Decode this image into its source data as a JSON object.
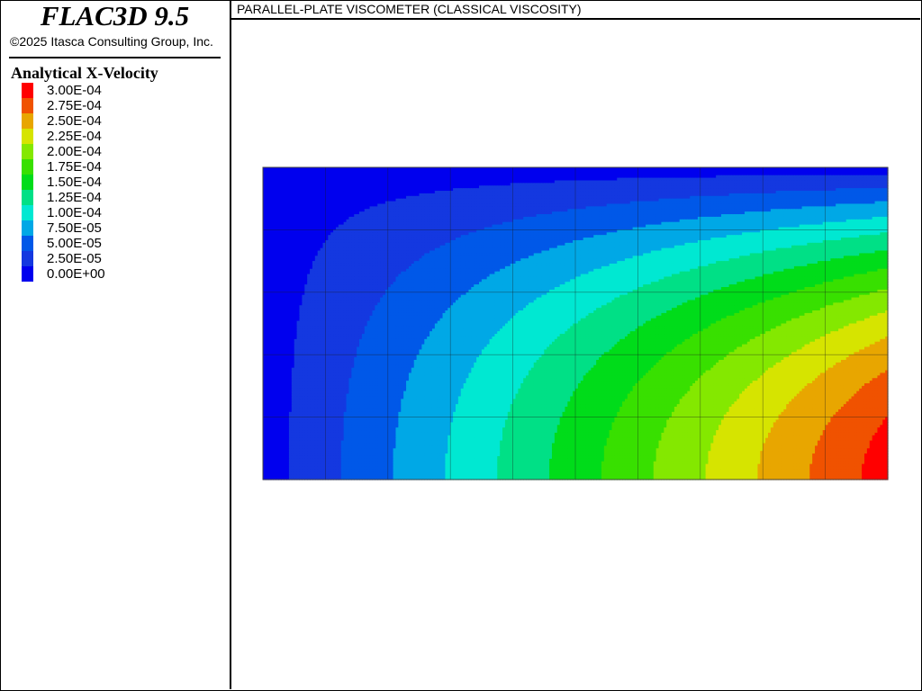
{
  "app": {
    "title": "FLAC3D 9.5",
    "copyright": "©2025 Itasca Consulting Group, Inc."
  },
  "view": {
    "title": "PARALLEL-PLATE VISCOMETER (CLASSICAL VISCOSITY)"
  },
  "legend": {
    "title": "Analytical X-Velocity",
    "entries": [
      {
        "label": "3.00E-04",
        "color": "#ff0000"
      },
      {
        "label": "2.75E-04",
        "color": "#f05200"
      },
      {
        "label": "2.50E-04",
        "color": "#e8a600"
      },
      {
        "label": "2.25E-04",
        "color": "#d6e400"
      },
      {
        "label": "2.00E-04",
        "color": "#84e800"
      },
      {
        "label": "1.75E-04",
        "color": "#38e000"
      },
      {
        "label": "1.50E-04",
        "color": "#00dc1a"
      },
      {
        "label": "1.25E-04",
        "color": "#00e086"
      },
      {
        "label": "1.00E-04",
        "color": "#00e8d2"
      },
      {
        "label": "7.50E-05",
        "color": "#00a8e6"
      },
      {
        "label": "5.00E-05",
        "color": "#0058e8"
      },
      {
        "label": "2.50E-05",
        "color": "#1438e0"
      },
      {
        "label": "0.00E+00",
        "color": "#0000ee"
      }
    ]
  },
  "model": {
    "grid_columns": 10,
    "grid_rows": 5,
    "contour_levels": 13
  }
}
